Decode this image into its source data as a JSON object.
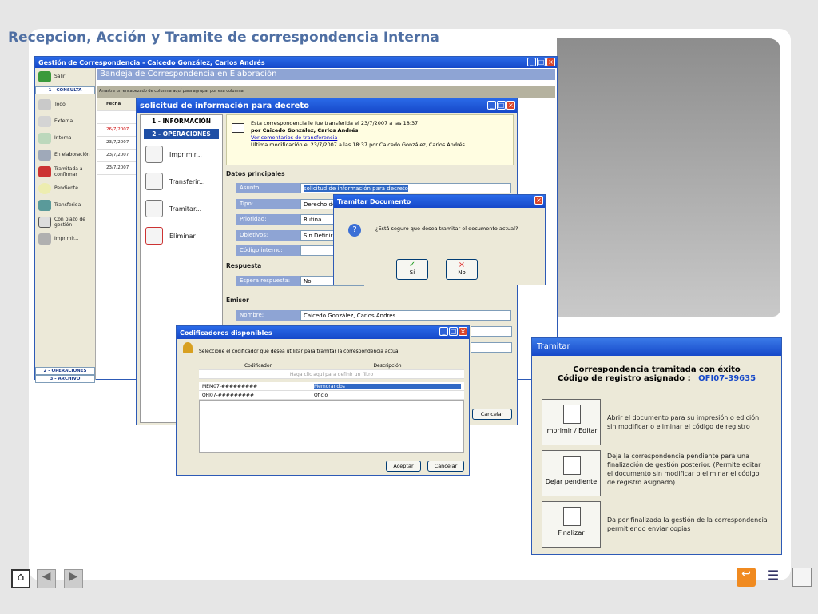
{
  "slide": {
    "title": "Recepcion, Acción y Tramite de correspondencia Interna"
  },
  "main_window": {
    "title": "Gestión de Correspondencia - Caicedo González, Carlos Andrés",
    "header": "Bandeja de Correspondencia en Elaboración",
    "group_hint": "Arrastre un encabezado de columna aquí para agrupar por esa columna",
    "sidebar": {
      "exit": "Salir",
      "section_consulta": "1 - CONSULTA",
      "items": [
        "Todo",
        "Externa",
        "Interna",
        "En elaboración",
        "Tramitada a confirmar",
        "Pendiente",
        "Transferida",
        "Con plazo de gestión",
        "Imprimir..."
      ],
      "section_operaciones": "2 - OPERACIONES",
      "section_archivo": "3 - ARCHIVO"
    },
    "grid": {
      "column": "Fecha",
      "dates": [
        "26/7/2007",
        "23/7/2007",
        "23/7/2007",
        "23/7/2007"
      ]
    }
  },
  "solicitud": {
    "title": "solicitud de información para decreto",
    "tab_info": "1 - INFORMACIÓN",
    "tab_ops": "2 - OPERACIONES",
    "ops": [
      "Imprimir...",
      "Transferir...",
      "Tramitar...",
      "Eliminar"
    ],
    "info_line1": "Esta correspondencia le fue transferida el 23/7/2007 a las 18:37",
    "info_line2": "por Caicedo González, Carlos Andrés",
    "info_link": "Ver comentarios de transferencia",
    "info_line3": "Ultima modificación el 23/7/2007 a las 18:37 por Caicedo González, Carlos Andrés.",
    "section_datos": "Datos principales",
    "fields": [
      {
        "label": "Asunto:",
        "value": "solicitud de información para decreto"
      },
      {
        "label": "Tipo:",
        "value": "Derecho de"
      },
      {
        "label": "Prioridad:",
        "value": "Rutina"
      },
      {
        "label": "Objetivos:",
        "value": "Sin Definir"
      },
      {
        "label": "Código interno:",
        "value": ""
      }
    ],
    "section_respuesta": "Respuesta",
    "espera_label": "Espera respuesta:",
    "espera_value": "No",
    "section_emisor": "Emisor",
    "nombre_label": "Nombre:",
    "nombre_value": "Caicedo González, Carlos Andrés",
    "cancel": "Cancelar"
  },
  "tramitar_documento": {
    "title": "Tramitar Documento",
    "question": "¿Está seguro que desea tramitar el documento actual?",
    "yes": "Sí",
    "no": "No"
  },
  "codificadores": {
    "title": "Codificadores disponibles",
    "prompt": "Seleccione el codificador que desea utilizar para tramitar la correspondencia actual",
    "col_codificador": "Codificador",
    "col_descripcion": "Descripción",
    "filter_hint": "Haga clic aquí para definir un filtro",
    "rows": [
      {
        "code": "MEM07-#########",
        "desc": "Memorandos"
      },
      {
        "code": "OFI07-#########",
        "desc": "Oficio"
      }
    ],
    "accept": "Aceptar",
    "cancel": "Cancelar"
  },
  "tramitar_result": {
    "title": "Tramitar",
    "success": "Correspondencia tramitada con éxito",
    "code_label": "Código de registro asignado :",
    "code_value": "OFI07-39635",
    "options": [
      {
        "button": "Imprimir / Editar",
        "text": "Abrir el documento para su impresión o edición sin modificar o eliminar el código de registro"
      },
      {
        "button": "Dejar pendiente",
        "text": "Deja la correspondencia pendiente para una finalización de gestión posterior. (Permite editar el documento sin modificar o eliminar el código de registro asignado)"
      },
      {
        "button": "Finalizar",
        "text": "Da por finalizada la gestión de la correspondencia permitiendo enviar copias"
      }
    ]
  },
  "colors": {
    "title_blue": "#4f6fa3",
    "xp_blue": "#1648c9",
    "field_label": "#8ea4d4"
  }
}
